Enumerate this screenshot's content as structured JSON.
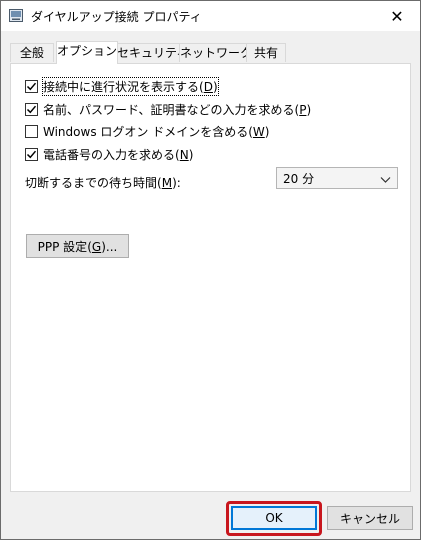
{
  "window": {
    "title": "ダイヤルアップ接続 プロパティ",
    "close_glyph": "✕"
  },
  "tabs": [
    {
      "label": "全般",
      "active": false
    },
    {
      "label": "オプション",
      "active": true
    },
    {
      "label": "セキュリティ",
      "active": false
    },
    {
      "label": "ネットワーク",
      "active": false
    },
    {
      "label": "共有",
      "active": false
    }
  ],
  "options": {
    "checkboxes": [
      {
        "label": "接続中に進行状況を表示する",
        "key": "D",
        "checked": true
      },
      {
        "label": "名前、パスワード、証明書などの入力を求める",
        "key": "P",
        "checked": true
      },
      {
        "label": "Windows ログオン ドメインを含める",
        "key": "W",
        "checked": false
      },
      {
        "label": "電話番号の入力を求める",
        "key": "N",
        "checked": true
      }
    ],
    "wait_label": "切断するまでの待ち時間",
    "wait_key": "M",
    "wait_suffix": ":",
    "wait_value": "20 分",
    "ppp_label": "PPP 設定",
    "ppp_key": "G",
    "ppp_suffix": "..."
  },
  "footer": {
    "ok_label": "OK",
    "cancel_label": "キャンセル"
  },
  "colors": {
    "highlight": "#c8161d",
    "ok_border": "#0078d7"
  }
}
